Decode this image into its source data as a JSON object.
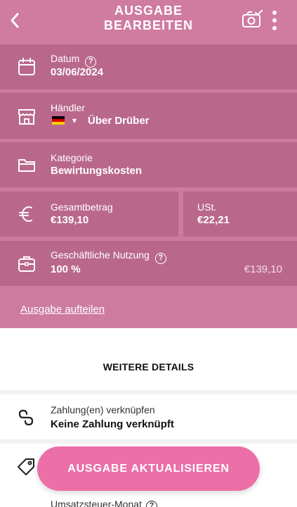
{
  "header": {
    "title_line1": "AUSGABE",
    "title_line2": "BEARBEITEN"
  },
  "fields": {
    "date": {
      "label": "Datum",
      "value": "03/06/2024",
      "icon": "calendar-icon"
    },
    "merchant": {
      "label": "Händler",
      "value": "Über Drüber",
      "country_arrow": "▾",
      "icon": "store-icon"
    },
    "category": {
      "label": "Kategorie",
      "value": "Bewirtungskosten",
      "icon": "folder-icon"
    },
    "total": {
      "label": "Gesamtbetrag",
      "value": "€139,10",
      "icon": "euro-icon"
    },
    "vat": {
      "label": "USt.",
      "value": "€22,21"
    },
    "business_use": {
      "label": "Geschäftliche Nutzung",
      "value": "100 %",
      "amount": "€139,10",
      "icon": "briefcase-icon"
    }
  },
  "split_link": "Ausgabe aufteilen",
  "more_details": {
    "title": "WEITERE DETAILS",
    "payment_label": "Zahlung(en) verknüpfen",
    "payment_value": "Keine Zahlung verknüpft",
    "partial_label": "Umsatzsteuer-Monat"
  },
  "cta_label": "AUSGABE AKTUALISIEREN",
  "help_glyph": "?",
  "colors": {
    "header": "#d07ba0",
    "row": "#b9688b",
    "button": "#ec6fa8"
  }
}
